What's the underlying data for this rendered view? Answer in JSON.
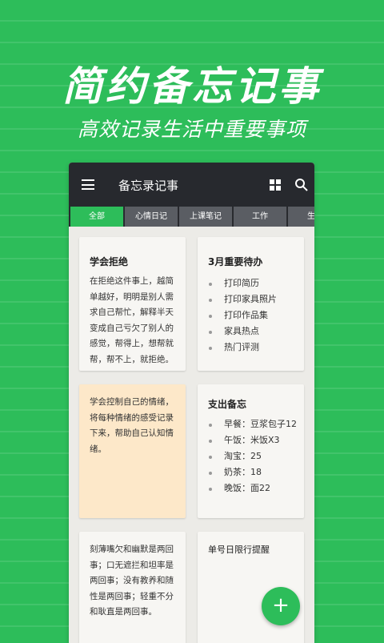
{
  "promo": {
    "title": "简约备忘记事",
    "subtitle": "高效记录生活中重要事项"
  },
  "appbar": {
    "title": "备忘录记事",
    "icons": [
      "menu-icon",
      "grid-view-icon",
      "search-icon"
    ]
  },
  "tabs": [
    "全部",
    "心情日记",
    "上课笔记",
    "工作",
    "生"
  ],
  "notes": {
    "n1": {
      "title": "学会拒绝",
      "body": "在拒绝这件事上，越简单越好，明明是别人需求自己帮忙，解释半天变成自己亏欠了别人的感觉，帮得上，想帮就帮，帮不上，就拒绝。"
    },
    "n2": {
      "title": "3月重要待办",
      "items": [
        "打印简历",
        "打印家具照片",
        "打印作品集",
        "家具热点",
        "热门评测"
      ]
    },
    "n3": {
      "body": "学会控制自己的情绪，将每种情绪的感受记录下来，帮助自己认知情绪。"
    },
    "n4": {
      "title": "支出备忘",
      "items": [
        "早餐：豆浆包子12",
        "午饭：米饭X3",
        "淘宝：25",
        "奶茶：18",
        "晚饭：面22"
      ]
    },
    "n5": {
      "body": "刻薄嘴欠和幽默是两回事；口无遮拦和坦率是两回事；没有教养和随性是两回事；轻重不分和耿直是两回事。"
    },
    "n6": {
      "title": "单号日限行提醒"
    }
  },
  "fab": {
    "label": "+"
  },
  "colors": {
    "accent": "#2dbd5a",
    "appbar": "#27292e",
    "yellow_note": "#fde8c9"
  }
}
